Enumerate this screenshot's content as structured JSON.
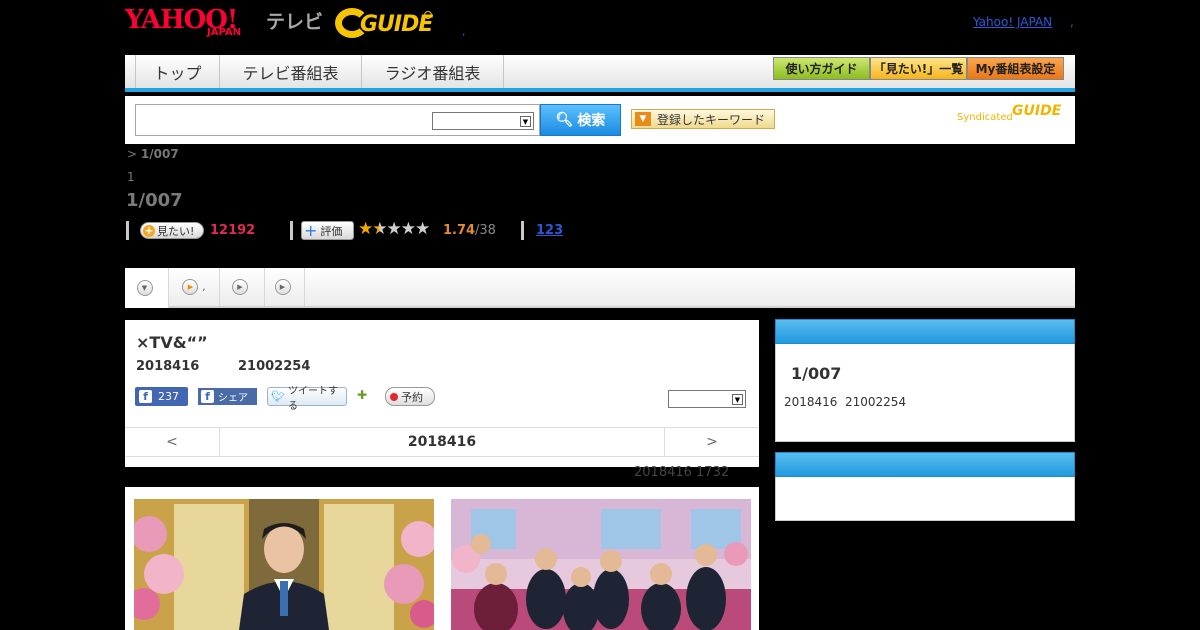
{
  "header": {
    "logo_yahoo": "YAHOO!",
    "logo_japan": "JAPAN",
    "logo_tv": "テレビ",
    "gguide_text": "GUIDE",
    "dot": ",",
    "yahoo_japan_link": "Yahoo! JAPAN",
    "yahoo_japan_dot": ","
  },
  "nav": {
    "tabs": [
      {
        "label": "トップ"
      },
      {
        "label": "テレビ番組表"
      },
      {
        "label": "ラジオ番組表"
      }
    ],
    "guide_label": "使い方ガイド",
    "mitai_list_label": "「見たい!」一覧",
    "my_bangumi_label": "My番組表設定"
  },
  "search": {
    "value": "",
    "select_value": "",
    "button_label": "検索",
    "keyword_label": "登録したキーワード",
    "syndicated": "Syndicated",
    "syndicated_g": "GUIDE"
  },
  "breadcrumb": {
    "prefix": ">",
    "current": "1/007"
  },
  "program": {
    "small_label": "1",
    "title": "1/007"
  },
  "stats": {
    "mitai_label": "見たい!",
    "mitai_count": "12192",
    "hyoka_label": "評価",
    "stars_filled": 1.5,
    "rating": "1.74",
    "rating_count": "/38",
    "reviews": "123"
  },
  "tabstrip": {
    "items": [
      {
        "label": ""
      },
      {
        "label": ","
      },
      {
        "label": ""
      },
      {
        "label": ""
      }
    ]
  },
  "main": {
    "title": "×TV&“”",
    "date": "2018416",
    "time": "21002254",
    "fb_like_count": "237",
    "fb_share_label": "シェア",
    "tweet_label": "ツイートする",
    "yoyaku_label": "予約",
    "select_value": "",
    "prev_label": "<",
    "nav_date": "2018416",
    "next_label": ">",
    "posted": "2018416  1732"
  },
  "sidebar": {
    "box1_title": "1/007",
    "box1_date": "2018416",
    "box1_time": "21002254"
  }
}
